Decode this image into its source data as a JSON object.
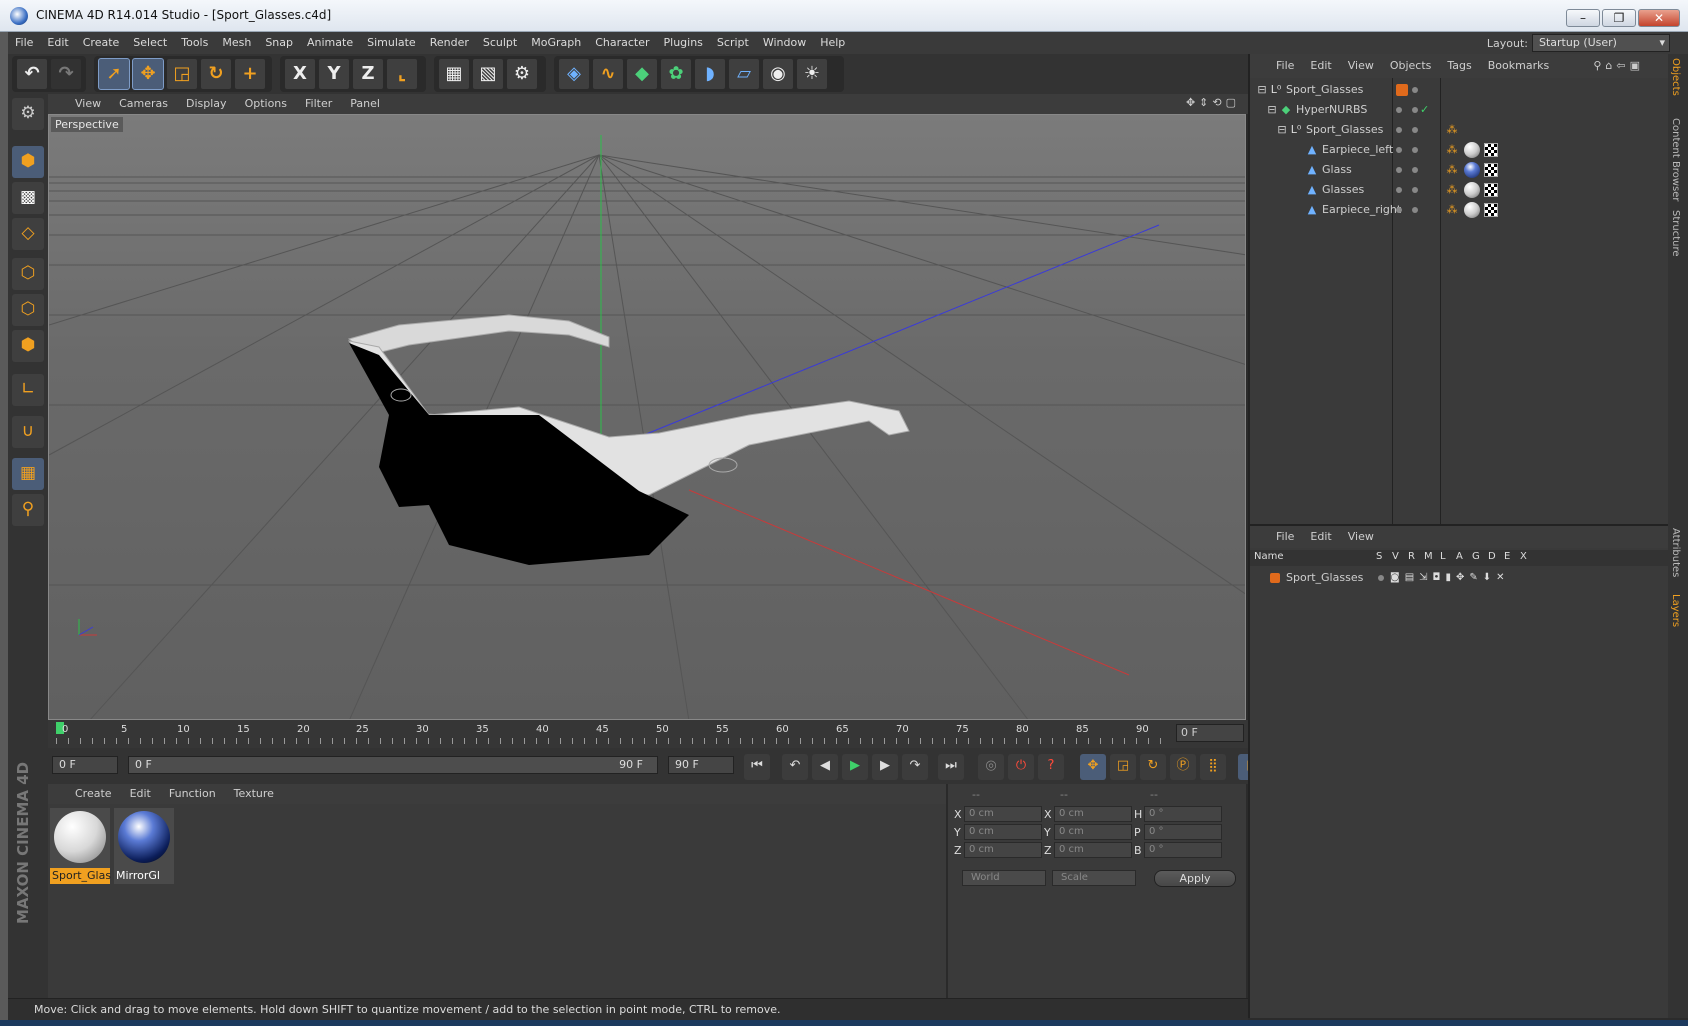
{
  "window": {
    "title": "CINEMA 4D R14.014 Studio - [Sport_Glasses.c4d]",
    "buttons": [
      "–",
      "❐",
      "✕"
    ]
  },
  "menubar": {
    "items": [
      "File",
      "Edit",
      "Create",
      "Select",
      "Tools",
      "Mesh",
      "Snap",
      "Animate",
      "Simulate",
      "Render",
      "Sculpt",
      "MoGraph",
      "Character",
      "Plugins",
      "Script",
      "Window",
      "Help"
    ],
    "layout_label": "Layout:",
    "layout_value": "Startup (User)"
  },
  "toolbar": {
    "icons": [
      "undo-icon",
      "redo-icon",
      "live-selection-icon",
      "move-icon",
      "scale-icon",
      "rotate-icon",
      "add-icon",
      "x-axis-icon",
      "y-axis-icon",
      "z-axis-icon",
      "coordinate-system-icon",
      "render-view-icon",
      "render-picture-viewer-icon",
      "render-settings-icon",
      "cube-icon",
      "spline-icon",
      "nurbs-icon",
      "mograph-cloner-icon",
      "deformer-icon",
      "floor-icon",
      "camera-icon",
      "light-icon"
    ],
    "axis_labels": [
      "X",
      "Y",
      "Z"
    ]
  },
  "viewport": {
    "menu": [
      "View",
      "Cameras",
      "Display",
      "Options",
      "Filter",
      "Panel"
    ],
    "label": "Perspective"
  },
  "timeline": {
    "ticks": [
      "0",
      "5",
      "10",
      "15",
      "20",
      "25",
      "30",
      "35",
      "40",
      "45",
      "50",
      "55",
      "60",
      "65",
      "70",
      "75",
      "80",
      "85",
      "90"
    ],
    "current_frame": "0 F"
  },
  "transport": {
    "start": "0 F",
    "range_start": "0 F",
    "range_end": "90 F",
    "end": "90 F"
  },
  "materials": {
    "menu": [
      "Create",
      "Edit",
      "Function",
      "Texture"
    ],
    "items": [
      {
        "name": "Sport_Glas"
      },
      {
        "name": "MirrorGl"
      }
    ]
  },
  "coordinates": {
    "headers": [
      "--",
      "--",
      "--"
    ],
    "rows": [
      {
        "a": "X",
        "av": "0 cm",
        "b": "X",
        "bv": "0 cm",
        "c": "H",
        "cv": "0 °"
      },
      {
        "a": "Y",
        "av": "0 cm",
        "b": "Y",
        "bv": "0 cm",
        "c": "P",
        "cv": "0 °"
      },
      {
        "a": "Z",
        "av": "0 cm",
        "b": "Z",
        "bv": "0 cm",
        "c": "B",
        "cv": "0 °"
      }
    ],
    "mode1": "World",
    "mode2": "Scale",
    "apply": "Apply"
  },
  "objects": {
    "menu": [
      "File",
      "Edit",
      "View",
      "Objects",
      "Tags",
      "Bookmarks"
    ],
    "items": [
      {
        "name": "Sport_Glasses"
      },
      {
        "name": "HyperNURBS"
      },
      {
        "name": "Sport_Glasses"
      },
      {
        "name": "Earpiece_left"
      },
      {
        "name": "Glass"
      },
      {
        "name": "Glasses"
      },
      {
        "name": "Earpiece_right"
      }
    ]
  },
  "layers": {
    "menu": [
      "File",
      "Edit",
      "View"
    ],
    "columns": [
      "Name",
      "S",
      "V",
      "R",
      "M",
      "L",
      "A",
      "G",
      "D",
      "E",
      "X"
    ],
    "rows": [
      {
        "name": "Sport_Glasses",
        "color": "#e06a1c"
      }
    ]
  },
  "side_tabs": [
    "Objects",
    "Content Browser",
    "Structure",
    "Attributes",
    "Layers"
  ],
  "brand": "MAXON CINEMA 4D",
  "status": "Move: Click and drag to move elements. Hold down SHIFT to quantize movement / add to the selection in point mode, CTRL to remove.",
  "colors": {
    "accent": "#f0a020",
    "selected": "#4b5d78",
    "bg": "#3a3a3a"
  }
}
